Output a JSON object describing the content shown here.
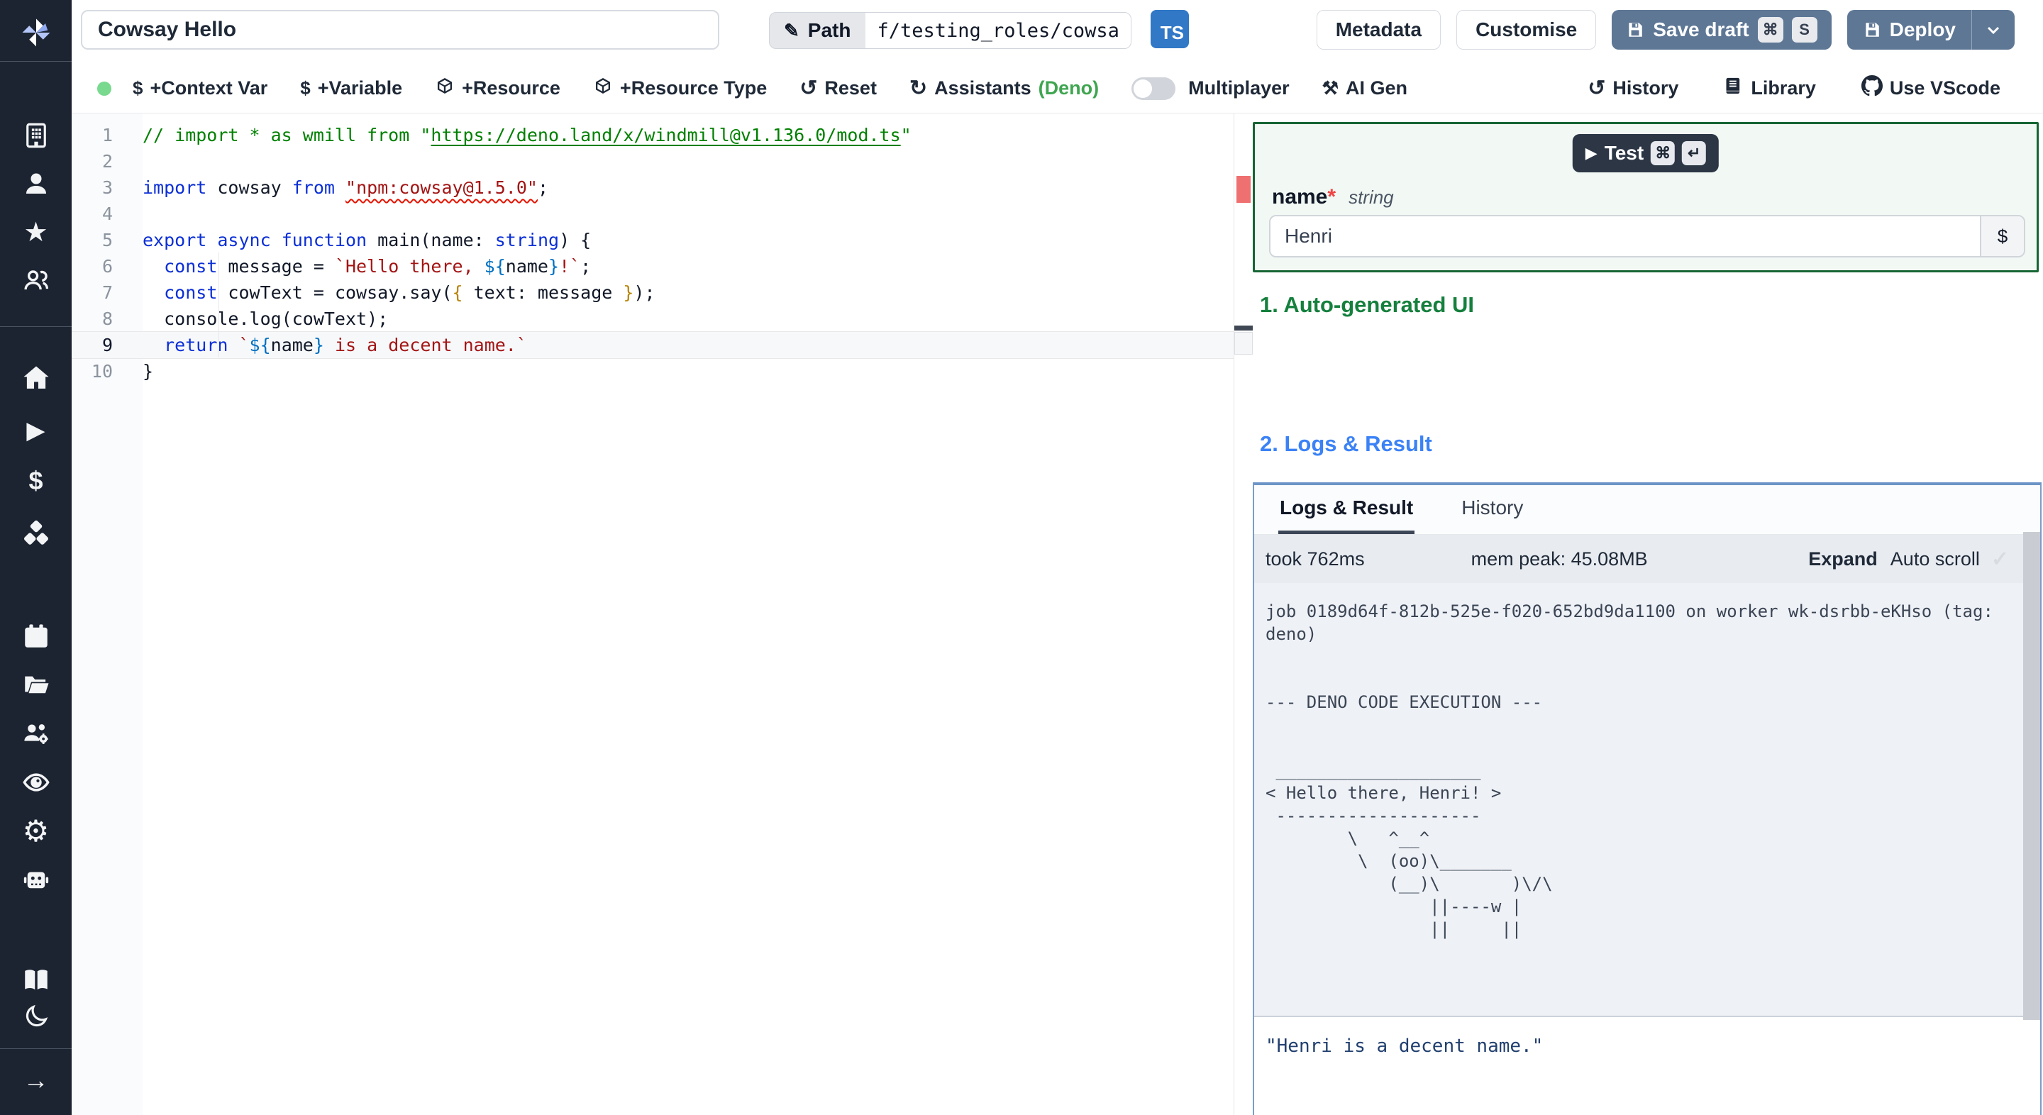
{
  "header": {
    "title_value": "Cowsay Hello",
    "path_label": "Path",
    "path_value": "f/testing_roles/cowsa",
    "lang_badge": "TS",
    "metadata_label": "Metadata",
    "customise_label": "Customise",
    "save_draft_label": "Save draft",
    "save_kbd": [
      "⌘",
      "S"
    ],
    "deploy_label": "Deploy"
  },
  "toolbar": {
    "left_items": [
      {
        "icon": "dollar-icon",
        "label": "+Context Var"
      },
      {
        "icon": "dollar-icon",
        "label": "+Variable"
      },
      {
        "icon": "package-icon",
        "label": "+Resource"
      },
      {
        "icon": "package-icon",
        "label": "+Resource Type"
      },
      {
        "icon": "undo-icon",
        "label": "Reset"
      },
      {
        "icon": "refresh-icon",
        "label": "Assistants",
        "suffix": "(Deno)"
      }
    ],
    "multiplayer_label": "Multiplayer",
    "ai_gen_label": "AI Gen",
    "right_items": [
      {
        "icon": "history-icon",
        "label": "History"
      },
      {
        "icon": "book-icon",
        "label": "Library"
      },
      {
        "icon": "github-icon",
        "label": "Use VScode"
      }
    ]
  },
  "sidebar": {
    "items": [
      "windmill-logo",
      "workspace",
      "user",
      "favorites",
      "groups",
      "home",
      "runs",
      "variables",
      "resources",
      "schedules",
      "folders",
      "workers",
      "audit-logs",
      "settings",
      "robot",
      "docs",
      "dark-mode",
      "expand"
    ]
  },
  "editor": {
    "active_line": 9,
    "lines": [
      {
        "num": 1,
        "segs": [
          {
            "c": "c",
            "t": "// import * as wmill from \""
          },
          {
            "c": "cl",
            "t": "https://deno.land/x/windmill@v1.136.0/mod.ts"
          },
          {
            "c": "c",
            "t": "\""
          }
        ]
      },
      {
        "num": 2,
        "segs": []
      },
      {
        "num": 3,
        "segs": [
          {
            "c": "k",
            "t": "import"
          },
          {
            "c": "d",
            "t": " cowsay "
          },
          {
            "c": "k",
            "t": "from"
          },
          {
            "c": "d",
            "t": " "
          },
          {
            "c": "e",
            "t": "\"npm:cowsay@1.5.0\""
          },
          {
            "c": "d",
            "t": ";"
          }
        ]
      },
      {
        "num": 4,
        "segs": []
      },
      {
        "num": 5,
        "segs": [
          {
            "c": "k",
            "t": "export"
          },
          {
            "c": "d",
            "t": " "
          },
          {
            "c": "k",
            "t": "async"
          },
          {
            "c": "d",
            "t": " "
          },
          {
            "c": "k",
            "t": "function"
          },
          {
            "c": "d",
            "t": " main(name: "
          },
          {
            "c": "k",
            "t": "string"
          },
          {
            "c": "d",
            "t": ") {"
          }
        ]
      },
      {
        "num": 6,
        "segs": [
          {
            "c": "d",
            "t": "  "
          },
          {
            "c": "k",
            "t": "const"
          },
          {
            "c": "d",
            "t": " message = "
          },
          {
            "c": "s",
            "t": "`Hello there, "
          },
          {
            "c": "t",
            "t": "${"
          },
          {
            "c": "d",
            "t": "name"
          },
          {
            "c": "t",
            "t": "}"
          },
          {
            "c": "s",
            "t": "!`"
          },
          {
            "c": "d",
            "t": ";"
          }
        ]
      },
      {
        "num": 7,
        "segs": [
          {
            "c": "d",
            "t": "  "
          },
          {
            "c": "k",
            "t": "const"
          },
          {
            "c": "d",
            "t": " cowText = cowsay.say("
          },
          {
            "c": "b",
            "t": "{"
          },
          {
            "c": "d",
            "t": " text: message "
          },
          {
            "c": "b",
            "t": "}"
          },
          {
            "c": "d",
            "t": ");"
          }
        ]
      },
      {
        "num": 8,
        "segs": [
          {
            "c": "d",
            "t": "  console.log(cowText);"
          }
        ]
      },
      {
        "num": 9,
        "segs": [
          {
            "c": "d",
            "t": "  "
          },
          {
            "c": "k",
            "t": "return"
          },
          {
            "c": "d",
            "t": " "
          },
          {
            "c": "s",
            "t": "`"
          },
          {
            "c": "t",
            "t": "${"
          },
          {
            "c": "d",
            "t": "name"
          },
          {
            "c": "t",
            "t": "}"
          },
          {
            "c": "s",
            "t": " is a decent name.`"
          }
        ]
      },
      {
        "num": 10,
        "segs": [
          {
            "c": "d",
            "t": "}"
          }
        ]
      }
    ]
  },
  "panel": {
    "test_label": "Test",
    "test_kbd": [
      "⌘",
      "↵"
    ],
    "field_name": "name",
    "field_required": "*",
    "field_type": "string",
    "field_value": "Henri",
    "field_button": "$",
    "section1": "1. Auto-generated UI",
    "section2": "2. Logs & Result",
    "tabs": [
      "Logs & Result",
      "History"
    ],
    "stats": {
      "took": "took 762ms",
      "mem": "mem peak: 45.08MB",
      "expand": "Expand",
      "autoscroll": "Auto scroll",
      "check": "✓"
    },
    "log_text": "job 0189d64f-812b-525e-f020-652bd9da1100 on worker wk-dsrbb-eKHso (tag:\ndeno)\n\n\n--- DENO CODE EXECUTION ---\n\n\n ____________________\n< Hello there, Henri! >\n --------------------\n        \\   ^__^\n         \\  (oo)\\_______\n            (__)\\       )\\/\\\n                ||----w |\n                ||     ||",
    "result_text": "\"Henri is a decent name.\""
  },
  "colors": {
    "accent_blue_button": "#5e7795",
    "ts_badge": "#3178c6",
    "form_border_green": "#166534",
    "heading_green": "#15803d",
    "heading_blue": "#3b82f6",
    "logs_border_blue": "#7b9cc9",
    "error_marker_red": "#ef7070",
    "deno_green": "#3fa550"
  }
}
